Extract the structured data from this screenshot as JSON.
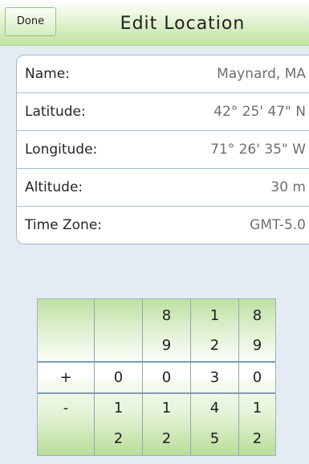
{
  "nav": {
    "done_label": "Done",
    "title": "Edit Location"
  },
  "fields": [
    {
      "label": "Name:",
      "value": "Maynard, MA"
    },
    {
      "label": "Latitude:",
      "value": "42° 25' 47\" N"
    },
    {
      "label": "Longitude:",
      "value": "71° 26' 35\" W"
    },
    {
      "label": "Altitude:",
      "value": "30 m"
    },
    {
      "label": "Time Zone:",
      "value": "GMT-5.0"
    }
  ],
  "picker": {
    "columns": [
      {
        "above": [
          "",
          ""
        ],
        "selected": "+",
        "below": [
          "-",
          ""
        ]
      },
      {
        "above": [
          "",
          ""
        ],
        "selected": "0",
        "below": [
          "1",
          "2"
        ]
      },
      {
        "above": [
          "8",
          "9"
        ],
        "selected": "0",
        "below": [
          "1",
          "2"
        ]
      },
      {
        "above": [
          "1",
          "2"
        ],
        "selected": "3",
        "below": [
          "4",
          "5"
        ]
      },
      {
        "above": [
          "8",
          "9"
        ],
        "selected": "0",
        "below": [
          "1",
          "2"
        ]
      }
    ]
  },
  "colors": {
    "title_bar_green": "#bfe3a2",
    "background": "#e4ebf2",
    "card_border": "#9fb7cf"
  }
}
